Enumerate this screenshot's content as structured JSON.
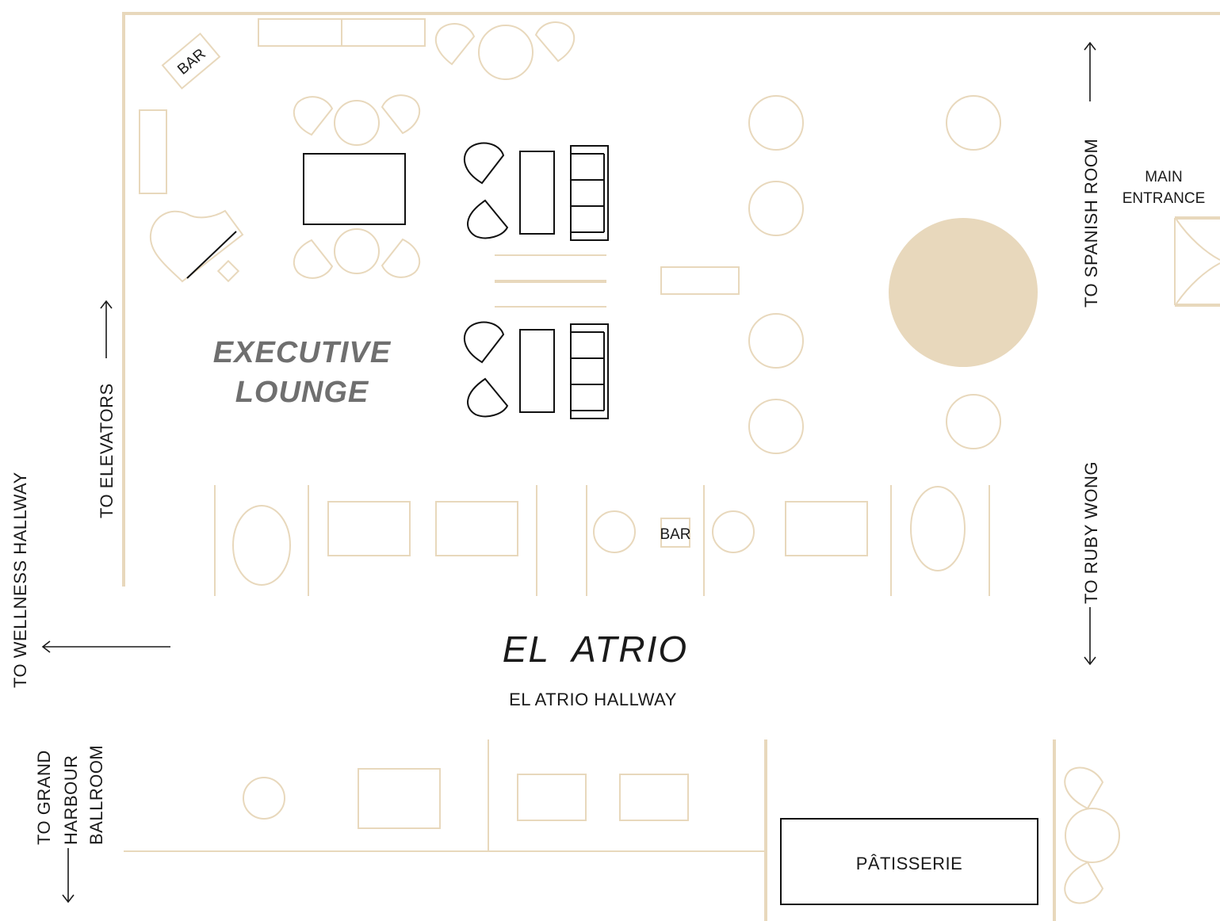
{
  "map": {
    "title_exec_line1": "EXECUTIVE",
    "title_exec_line2": "LOUNGE",
    "title_atrio": "EL  ATRIO",
    "hallway": "EL ATRIO HALLWAY",
    "bar_corner": "BAR",
    "bar_counter": "BAR",
    "patisserie": "PÂTISSERIE",
    "main_entrance_line1": "MAIN",
    "main_entrance_line2": "ENTRANCE",
    "to_spanish_room": "TO SPANISH ROOM",
    "to_ruby_wong": "TO RUBY WONG",
    "to_elevators": "TO ELEVATORS",
    "to_wellness_hallway": "TO WELLNESS HALLWAY",
    "to_grand_line1": "TO GRAND",
    "to_grand_line2": "HARBOUR",
    "to_grand_line3": "BALLROOM"
  },
  "colors": {
    "wall": "#e8d8bc",
    "furniture_dark": "#111111",
    "feature_fill": "#e8d8bc",
    "text": "#1a1a1a",
    "lounge_title": "#6f6f6f"
  }
}
